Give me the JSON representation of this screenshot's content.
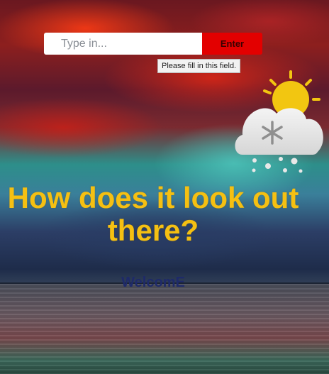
{
  "search": {
    "placeholder": "Type in...",
    "button_label": "Enter",
    "validation_tooltip": "Please fill in this field."
  },
  "weather_icon": {
    "icon": "snow-sun-cloud-icon",
    "colors": {
      "sun": "#f2c611",
      "cloud": "#e6e6e6",
      "snowflake": "#8f8f8f"
    }
  },
  "main": {
    "headline": "How does it look out there?",
    "welcome": "WelcomE"
  },
  "colors": {
    "headline": "#f5c012",
    "welcome": "#1e2a6a",
    "button": "#e30000"
  }
}
